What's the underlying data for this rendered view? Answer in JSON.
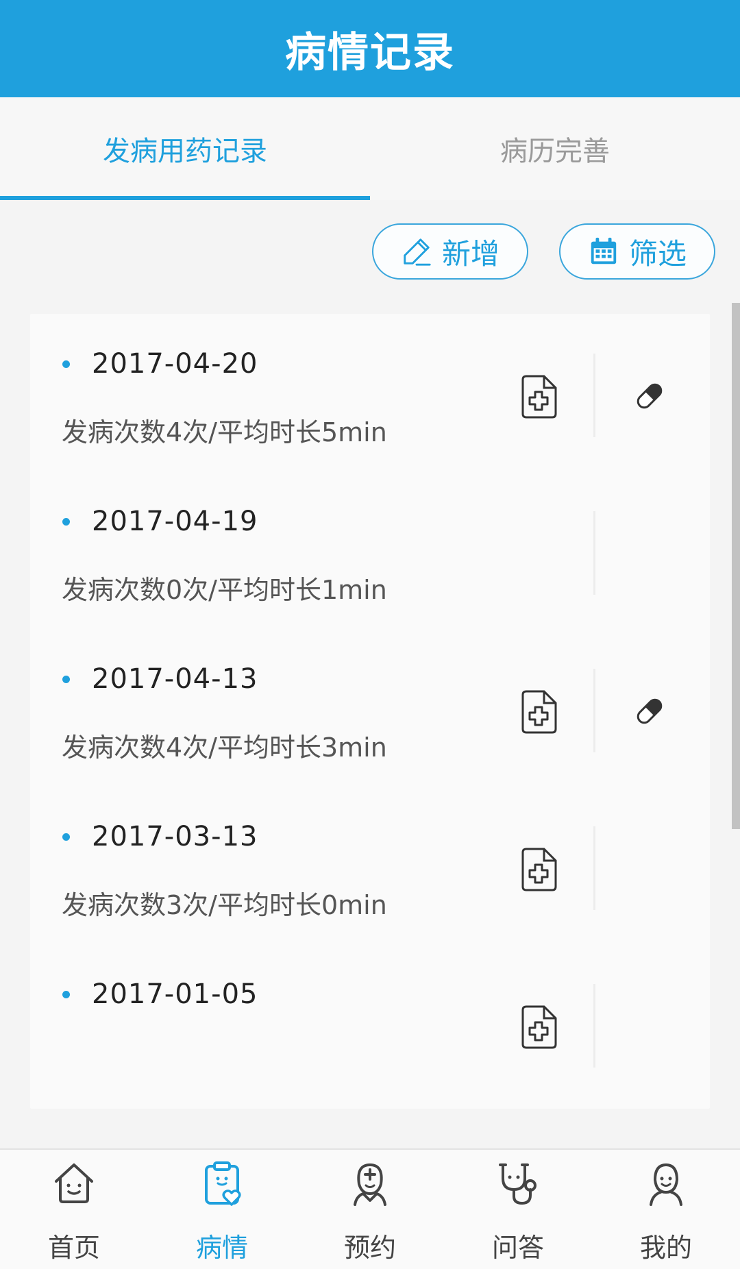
{
  "header": {
    "title": "病情记录"
  },
  "tabs": [
    {
      "label": "发病用药记录",
      "active": true
    },
    {
      "label": "病历完善",
      "active": false
    }
  ],
  "toolbar": {
    "add_label": "新增",
    "add_icon": "pen-icon",
    "filter_label": "筛选",
    "filter_icon": "calendar-icon"
  },
  "records": [
    {
      "date": "2017-04-20",
      "summary": "发病次数4次/平均时长5min",
      "has_record_icon": true,
      "has_medicine_icon": true
    },
    {
      "date": "2017-04-19",
      "summary": "发病次数0次/平均时长1min",
      "has_record_icon": false,
      "has_medicine_icon": false
    },
    {
      "date": "2017-04-13",
      "summary": "发病次数4次/平均时长3min",
      "has_record_icon": true,
      "has_medicine_icon": true
    },
    {
      "date": "2017-03-13",
      "summary": "发病次数3次/平均时长0min",
      "has_record_icon": true,
      "has_medicine_icon": false
    },
    {
      "date": "2017-01-05",
      "summary": "",
      "has_record_icon": true,
      "has_medicine_icon": false
    }
  ],
  "bottom_nav": [
    {
      "label": "首页",
      "icon": "home-icon",
      "active": false
    },
    {
      "label": "病情",
      "icon": "clipboard-heart-icon",
      "active": true
    },
    {
      "label": "预约",
      "icon": "doctor-icon",
      "active": false
    },
    {
      "label": "问答",
      "icon": "stethoscope-icon",
      "active": false
    },
    {
      "label": "我的",
      "icon": "user-icon",
      "active": false
    }
  ],
  "colors": {
    "accent": "#1fa0dd",
    "background": "#f4f4f4",
    "card": "#fafafa"
  }
}
